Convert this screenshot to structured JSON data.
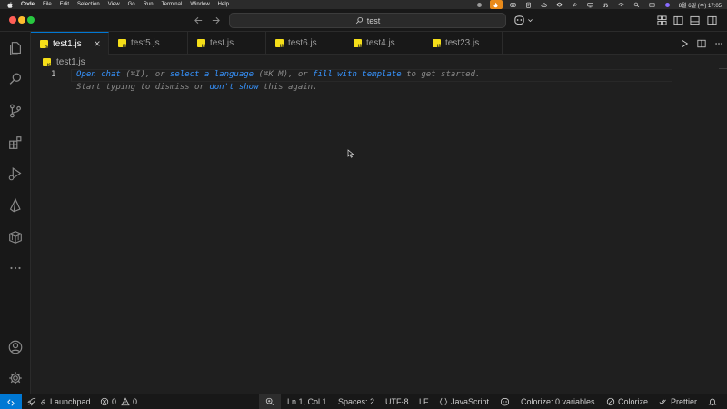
{
  "menubar": {
    "app": "Code",
    "items": [
      "File",
      "Edit",
      "Selection",
      "View",
      "Go",
      "Run",
      "Terminal",
      "Window",
      "Help"
    ],
    "clock": "8월 6일 (수) 17:05"
  },
  "titlebar": {
    "search": "test"
  },
  "tabs": [
    {
      "label": "test1.js",
      "active": true
    },
    {
      "label": "test5.js",
      "active": false
    },
    {
      "label": "test.js",
      "active": false
    },
    {
      "label": "test6.js",
      "active": false
    },
    {
      "label": "test4.js",
      "active": false
    },
    {
      "label": "test23.js",
      "active": false
    }
  ],
  "breadcrumb": "test1.js",
  "editor": {
    "line_number": "1",
    "hint_line1": {
      "link1": "Open chat",
      "text1": " (⌘I), or ",
      "link2": "select a language",
      "text2": " (⌘K M), or ",
      "link3": "fill with template",
      "text3": " to get started."
    },
    "hint_line2": {
      "text1": "Start typing to dismiss or ",
      "link1": "don't show",
      "text2": " this again."
    }
  },
  "statusbar": {
    "launchpad": "Launchpad",
    "errors": "0",
    "warnings": "0",
    "position": "Ln 1, Col 1",
    "spaces": "Spaces: 2",
    "encoding": "UTF-8",
    "eol": "LF",
    "language": "JavaScript",
    "colorize_vars": "Colorize: 0 variables",
    "colorize": "Colorize",
    "prettier": "Prettier"
  },
  "colors": {
    "accent": "#0078d4",
    "link": "#3794ff",
    "editor_bg": "#1f1f1f",
    "chrome_bg": "#181818",
    "js_icon": "#f5de19"
  }
}
